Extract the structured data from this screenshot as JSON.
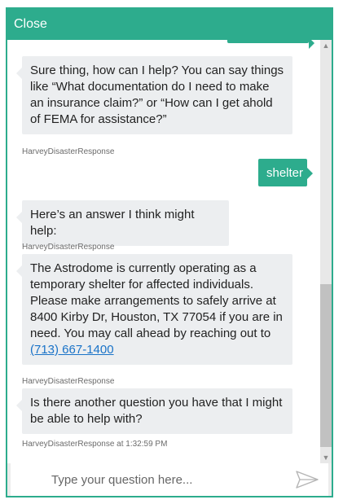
{
  "header": {
    "close_label": "Close"
  },
  "messages": [
    {
      "from": "bot",
      "text": "Sure thing, how can I help? You can say things like “What documentation do I need to make an insurance claim?” or “How can I get ahold of FEMA for assistance?”",
      "sender": "HarveyDisasterResponse"
    },
    {
      "from": "user",
      "text": "shelter"
    },
    {
      "from": "bot",
      "text": "Here’s an answer I think might help:",
      "sender": "HarveyDisasterResponse"
    },
    {
      "from": "bot",
      "text": "The Astrodome is currently operating as a temporary shelter for affected individuals. Please make arrangements to safely arrive at 8400 Kirby Dr, Houston, TX 77054 if you are in need.  You may call ahead by reaching out to",
      "link": "(713) 667-1400",
      "sender": "HarveyDisasterResponse"
    },
    {
      "from": "bot",
      "text": "Is there another question you have that I might be able to help with?",
      "sender": "HarveyDisasterResponse at 1:32:59 PM"
    }
  ],
  "input": {
    "placeholder": "Type your question here...",
    "value": ""
  },
  "icons": {
    "send": "send-arrow-icon",
    "scroll_up": "chevron-up-icon",
    "scroll_down": "chevron-down-icon"
  },
  "colors": {
    "accent": "#2dac8d",
    "bot_bubble": "#eceef0",
    "link": "#1a73c8"
  }
}
